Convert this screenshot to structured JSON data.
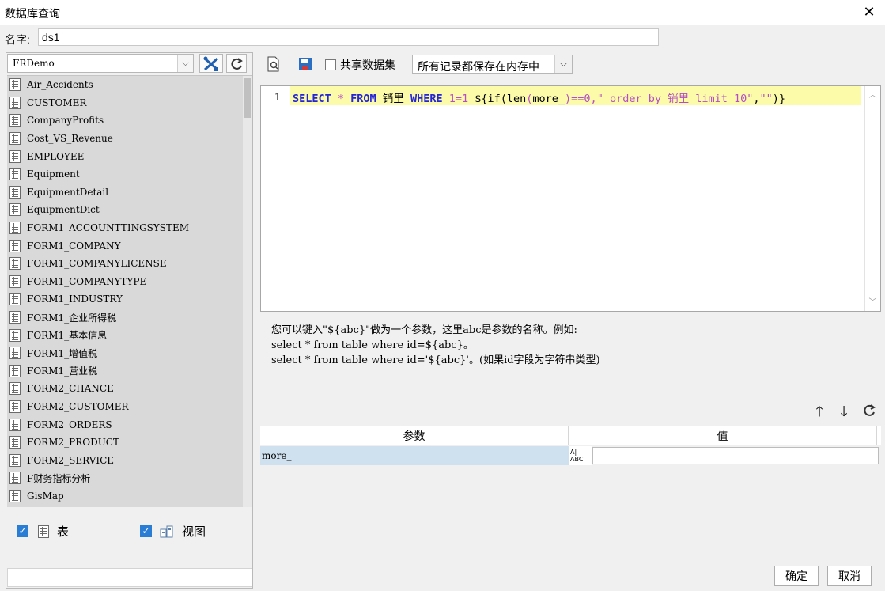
{
  "window": {
    "title": "数据库查询",
    "close_icon": "close-icon"
  },
  "name_field": {
    "label": "名字:",
    "value": "ds1"
  },
  "left_panel": {
    "datasource": "FRDemo",
    "tables": [
      "Air_Accidents",
      "CUSTOMER",
      "CompanyProfits",
      "Cost_VS_Revenue",
      "EMPLOYEE",
      "Equipment",
      "EquipmentDetail",
      "EquipmentDict",
      "FORM1_ACCOUNTTINGSYSTEM",
      "FORM1_COMPANY",
      "FORM1_COMPANYLICENSE",
      "FORM1_COMPANYTYPE",
      "FORM1_INDUSTRY",
      "FORM1_企业所得税",
      "FORM1_基本信息",
      "FORM1_增值税",
      "FORM1_营业税",
      "FORM2_CHANCE",
      "FORM2_CUSTOMER",
      "FORM2_ORDERS",
      "FORM2_PRODUCT",
      "FORM2_SERVICE",
      "F财务指标分析",
      "GisMap"
    ],
    "check_table": {
      "label": "表",
      "checked": true
    },
    "check_view": {
      "label": "视图",
      "checked": true
    }
  },
  "toolbar": {
    "share_label": "共享数据集",
    "memory_mode": "所有记录都保存在内存中"
  },
  "editor": {
    "line_number": "1",
    "tokens": {
      "select": "SELECT",
      "star": " * ",
      "from": "FROM",
      "table": " 销里 ",
      "where": "WHERE",
      "cond": " 1=1 ",
      "expr_open": "${if(",
      "fn_len": "len",
      "paren_open": "(",
      "var": "more_",
      "expr_mid": ")==0,",
      "str1": "\" order by 销里 limit 10\"",
      "comma": ",",
      "str2": "\"\"",
      "expr_close": ")}"
    }
  },
  "hint": {
    "line1": "您可以键入\"${abc}\"做为一个参数，这里abc是参数的名称。例如:",
    "line2": "select * from table where id=${abc}。",
    "line3": "select * from table where id='${abc}'。(如果id字段为字符串类型)"
  },
  "params": {
    "col_name": "参数",
    "col_value": "值",
    "rows": [
      {
        "name": "more_",
        "type_icon_top": "A|",
        "type_icon_bottom": "ABC",
        "value": ""
      }
    ]
  },
  "footer": {
    "ok": "确定",
    "cancel": "取消"
  }
}
